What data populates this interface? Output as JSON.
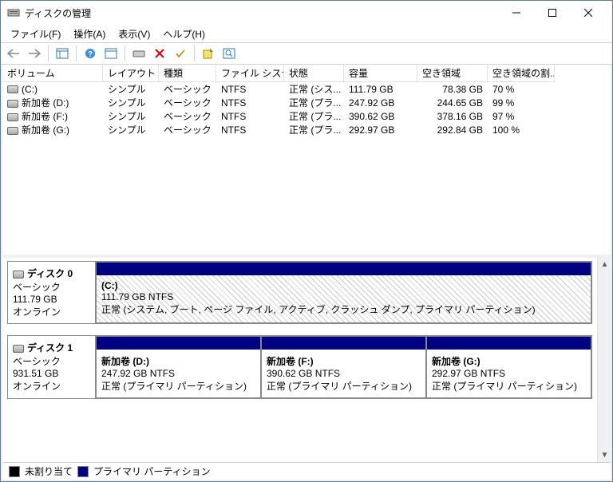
{
  "window": {
    "title": "ディスクの管理"
  },
  "menu": {
    "file": "ファイル(F)",
    "action": "操作(A)",
    "view": "表示(V)",
    "help": "ヘルプ(H)"
  },
  "columns": {
    "volume": "ボリューム",
    "layout": "レイアウト",
    "type": "種類",
    "filesystem": "ファイル システム",
    "status": "状態",
    "capacity": "容量",
    "free": "空き領域",
    "freepct": "空き領域の割..."
  },
  "volumes": [
    {
      "name": "(C:)",
      "layout": "シンプル",
      "type": "ベーシック",
      "fs": "NTFS",
      "status": "正常 (シス...",
      "capacity": "111.79 GB",
      "free": "78.38 GB",
      "pct": "70 %"
    },
    {
      "name": "新加卷 (D:)",
      "layout": "シンプル",
      "type": "ベーシック",
      "fs": "NTFS",
      "status": "正常 (プラ...",
      "capacity": "247.92 GB",
      "free": "244.65 GB",
      "pct": "99 %"
    },
    {
      "name": "新加卷 (F:)",
      "layout": "シンプル",
      "type": "ベーシック",
      "fs": "NTFS",
      "status": "正常 (プラ...",
      "capacity": "390.62 GB",
      "free": "378.16 GB",
      "pct": "97 %"
    },
    {
      "name": "新加卷 (G:)",
      "layout": "シンプル",
      "type": "ベーシック",
      "fs": "NTFS",
      "status": "正常 (プラ...",
      "capacity": "292.97 GB",
      "free": "292.84 GB",
      "pct": "100 %"
    }
  ],
  "disks": [
    {
      "name": "ディスク 0",
      "type": "ベーシック",
      "size": "111.79 GB",
      "status": "オンライン",
      "hatch": true,
      "partitions": [
        {
          "name": "(C:)",
          "sizefs": "111.79 GB NTFS",
          "status": "正常 (システム, ブート, ページ ファイル, アクティブ, クラッシュ ダンプ, プライマリ パーティション)"
        }
      ]
    },
    {
      "name": "ディスク 1",
      "type": "ベーシック",
      "size": "931.51 GB",
      "status": "オンライン",
      "hatch": false,
      "partitions": [
        {
          "name": "新加卷  (D:)",
          "sizefs": "247.92 GB NTFS",
          "status": "正常 (プライマリ パーティション)"
        },
        {
          "name": "新加卷  (F:)",
          "sizefs": "390.62 GB NTFS",
          "status": "正常 (プライマリ パーティション)"
        },
        {
          "name": "新加卷  (G:)",
          "sizefs": "292.97 GB NTFS",
          "status": "正常 (プライマリ パーティション)"
        }
      ]
    }
  ],
  "legend": {
    "unalloc": "未割り当て",
    "primary": "プライマリ パーティション"
  },
  "colors": {
    "primary": "#000080",
    "unalloc": "#000000"
  }
}
